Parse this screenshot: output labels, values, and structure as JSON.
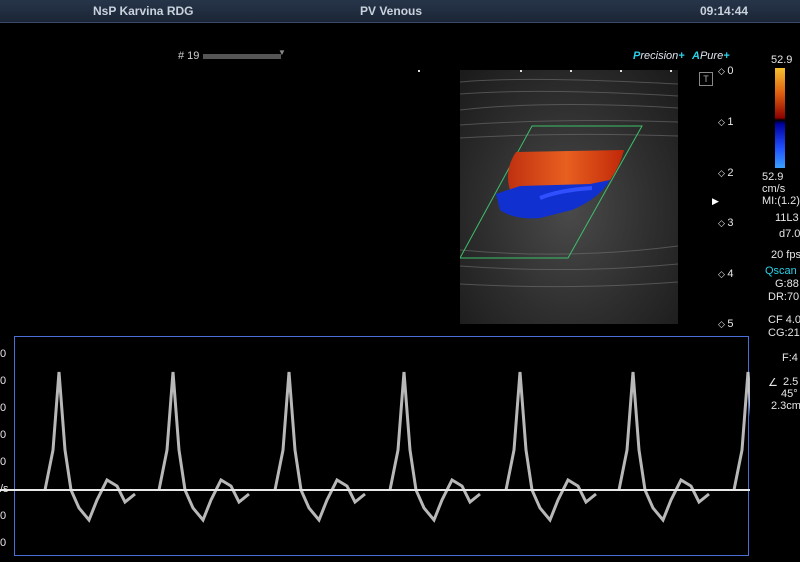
{
  "header": {
    "hospital": "NsP Karvina  RDG",
    "preset": "PV Venous",
    "time": "09:14:44"
  },
  "frame": {
    "label": "# 19"
  },
  "brand": {
    "precision_p": "P",
    "precision_rest": "recision",
    "plus1": "+",
    "pure_a": "A",
    "pure_rest": "Pure",
    "plus2": "+"
  },
  "depth_scale": [
    "0",
    "1",
    "2",
    "3",
    "4",
    "5"
  ],
  "color_scale": {
    "top_value": "52.9",
    "bottom_value": "52.9",
    "unit": "cm/s"
  },
  "params": {
    "mi": "MI:(1.2)",
    "probe": "11L3",
    "depth": "d7.0",
    "fps": "20 fps",
    "qscan": "Qscan",
    "gain": "G:88",
    "dr": "DR:70",
    "cf": "CF 4.0",
    "cg": "CG:21",
    "f": "F:4",
    "flow_sym": "∠",
    "pw": "2.5",
    "angle": "45°",
    "gate": "2.3cm"
  },
  "spectrum": {
    "axis_ticks": [
      "0",
      "0",
      "0",
      "0",
      "0"
    ],
    "baseline_label": "/s",
    "below_ticks": [
      "0",
      "0"
    ],
    "chart_data": {
      "type": "line",
      "note_series": "doppler velocity peaks",
      "peaks_x": [
        44,
        158,
        274,
        389,
        505,
        618,
        733
      ]
    }
  },
  "colors": {
    "frame_border": "#4a6fd6",
    "accent": "#2ad0e8"
  }
}
